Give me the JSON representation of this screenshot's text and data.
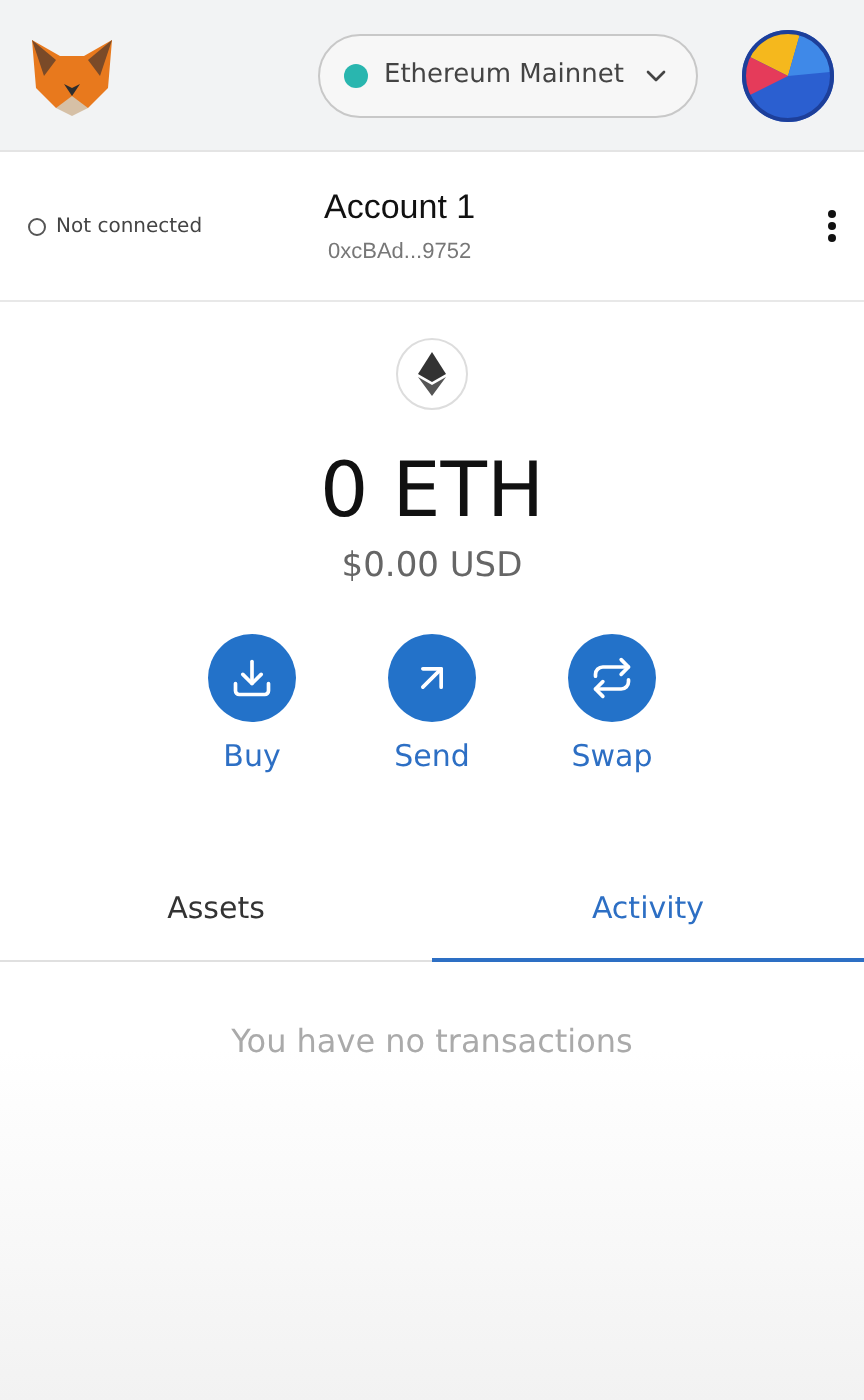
{
  "header": {
    "network": {
      "label": "Ethereum Mainnet"
    }
  },
  "account": {
    "connection": {
      "label": "Not connected",
      "connected": false
    },
    "name": "Account 1",
    "address": "0xcBAd...9752"
  },
  "balance": {
    "amount": "0 ETH",
    "fiat": "$0.00 USD"
  },
  "actions": [
    {
      "kind": "buy",
      "label": "Buy"
    },
    {
      "kind": "send",
      "label": "Send"
    },
    {
      "kind": "swap",
      "label": "Swap"
    }
  ],
  "tabs": [
    {
      "label": "Assets",
      "selected": false
    },
    {
      "label": "Activity",
      "selected": true
    }
  ],
  "activity": {
    "empty_message": "You have no transactions"
  }
}
